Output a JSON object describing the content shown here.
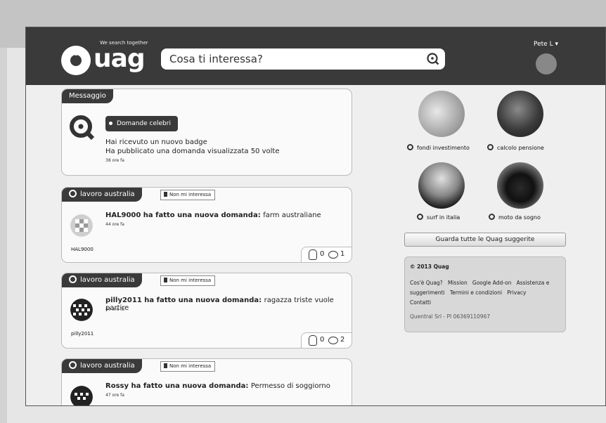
{
  "header": {
    "tagline": "We search together",
    "logo_text": "uag",
    "search_placeholder": "Cosa ti interessa?",
    "user_name": "Pete L ▾"
  },
  "message_card": {
    "tag": "Messaggio",
    "badge": "Domande celebri",
    "line1": "Hai ricevuto un nuovo badge",
    "line2": "Ha pubblicato una domanda visualizzata 50 volte",
    "time": "38 ore fa"
  },
  "feed": [
    {
      "tag": "lavoro australia",
      "not_interested": "Non mi interessa",
      "user": "HAL9000",
      "action": " ha fatto una nuova domanda: ",
      "question": "farm australiane",
      "time": "44 ore fa",
      "likes": "0",
      "comments": "1"
    },
    {
      "tag": "lavoro australia",
      "not_interested": "Non mi interessa",
      "user": "pilly2011",
      "action": " ha fatto una nuova domanda: ",
      "question": "ragazza triste vuole partire",
      "time": "46 ore fa",
      "likes": "0",
      "comments": "2"
    },
    {
      "tag": "lavoro australia",
      "not_interested": "Non mi interessa",
      "user": "Rossy",
      "action": " ha fatto una nuova domanda: ",
      "question": "Permesso di soggiorno",
      "time": "47 ore fa"
    }
  ],
  "suggestions": [
    {
      "label": "fondi investimento"
    },
    {
      "label": "calcolo pensione"
    },
    {
      "label": "surf in italia"
    },
    {
      "label": "moto da sogno"
    }
  ],
  "all_suggestions_button": "Guarda tutte le Quag suggerite",
  "footer": {
    "copyright": "© 2013 Quag",
    "links": [
      "Cos'è Quag?",
      "Mission",
      "Google Add-on",
      "Assistenza e suggerimenti",
      "Termini e condizioni",
      "Privacy",
      "Contatti"
    ],
    "company": "Quentral Srl - PI 06369110967"
  },
  "colors": {
    "header": "#3a3a3a",
    "page": "#efefef",
    "frame": "#e6e6e6"
  }
}
